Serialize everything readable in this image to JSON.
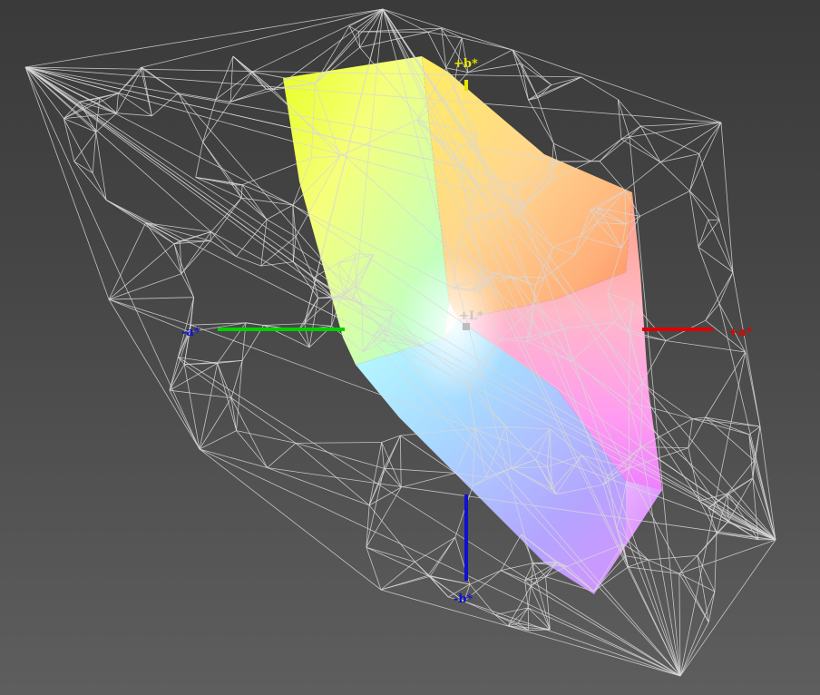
{
  "axes": {
    "plus_b": "+b*",
    "minus_b": "-b*",
    "plus_a": "+a*",
    "minus_a": "-a*",
    "plus_l": "+L*"
  },
  "colors": {
    "background": "#464646",
    "wireframe": "#d8d8d8",
    "axis_plus_b": "#e6e600",
    "axis_minus_b": "#1010d0",
    "axis_plus_a": "#e00000",
    "axis_minus_a": "#00d000",
    "axis_l": "#bdbdbd"
  }
}
